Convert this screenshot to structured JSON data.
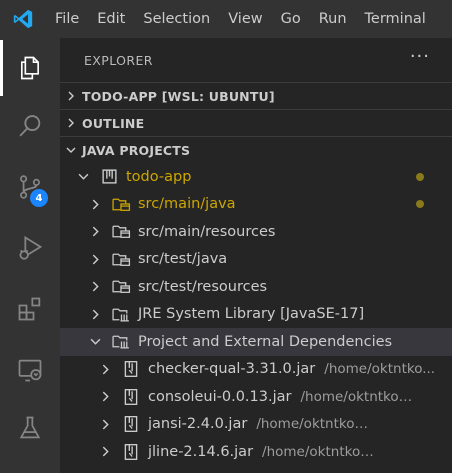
{
  "menu": [
    "File",
    "Edit",
    "Selection",
    "View",
    "Go",
    "Run",
    "Terminal"
  ],
  "activity": [
    "explorer-icon",
    "search-icon",
    "source-control-icon",
    "run-debug-icon",
    "extensions-icon",
    "remote-explorer-icon",
    "testing-icon"
  ],
  "scm_badge": "4",
  "explorer": {
    "title": "EXPLORER",
    "more": "···",
    "sections": {
      "workspace": "TODO-APP [WSL: UBUNTU]",
      "outline": "OUTLINE",
      "java": "JAVA PROJECTS"
    }
  },
  "tree": {
    "project": "todo-app",
    "items": [
      {
        "label": "src/main/java"
      },
      {
        "label": "src/main/resources"
      },
      {
        "label": "src/test/java"
      },
      {
        "label": "src/test/resources"
      },
      {
        "label": "JRE System Library [JavaSE-17]"
      },
      {
        "label": "Project and External Dependencies"
      }
    ],
    "jars": [
      {
        "name": "checker-qual-3.31.0.jar",
        "path": "/home/oktntko..."
      },
      {
        "name": "consoleui-0.0.13.jar",
        "path": "/home/oktntko/.gr..."
      },
      {
        "name": "jansi-2.4.0.jar",
        "path": "/home/oktntko/.gradle/ca..."
      },
      {
        "name": "jline-2.14.6.jar",
        "path": "/home/oktntko/.gradle/c..."
      }
    ]
  },
  "colors": {
    "modified": "#cca700",
    "accent": "#0078d4",
    "badge": "#1a85ff"
  }
}
